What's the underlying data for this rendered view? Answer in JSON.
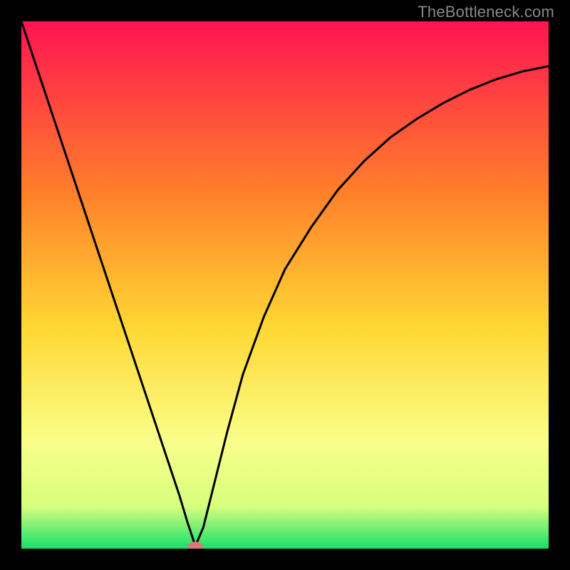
{
  "watermark": "TheBottleneck.com",
  "chart_data": {
    "type": "line",
    "title": "",
    "xlabel": "",
    "ylabel": "",
    "xlim": [
      0,
      100
    ],
    "ylim": [
      0,
      100
    ],
    "grid": false,
    "gradient_stops": {
      "top": "#ff1451",
      "mid_upper": "#ff7e2a",
      "mid": "#ffd733",
      "lower": "#faff8a",
      "band": "#d6ff7d",
      "bottom": "#18e06a"
    },
    "series": [
      {
        "name": "curve",
        "x": [
          0,
          3,
          6,
          9,
          12,
          15,
          18,
          21,
          24,
          27,
          30,
          31.5,
          33,
          34.5,
          36,
          39,
          42,
          46,
          50,
          55,
          60,
          65,
          70,
          75,
          80,
          85,
          90,
          95,
          100
        ],
        "y": [
          100,
          91,
          82,
          73,
          64,
          55,
          46,
          37,
          28,
          19,
          10,
          5,
          0.5,
          4,
          10,
          22,
          33,
          44,
          53,
          61,
          68,
          73.5,
          78,
          81.5,
          84.5,
          87,
          89,
          90.5,
          91.5
        ]
      }
    ],
    "marker": {
      "x": 33,
      "y": 0.5,
      "rx": 1.5,
      "ry": 0.8
    }
  }
}
